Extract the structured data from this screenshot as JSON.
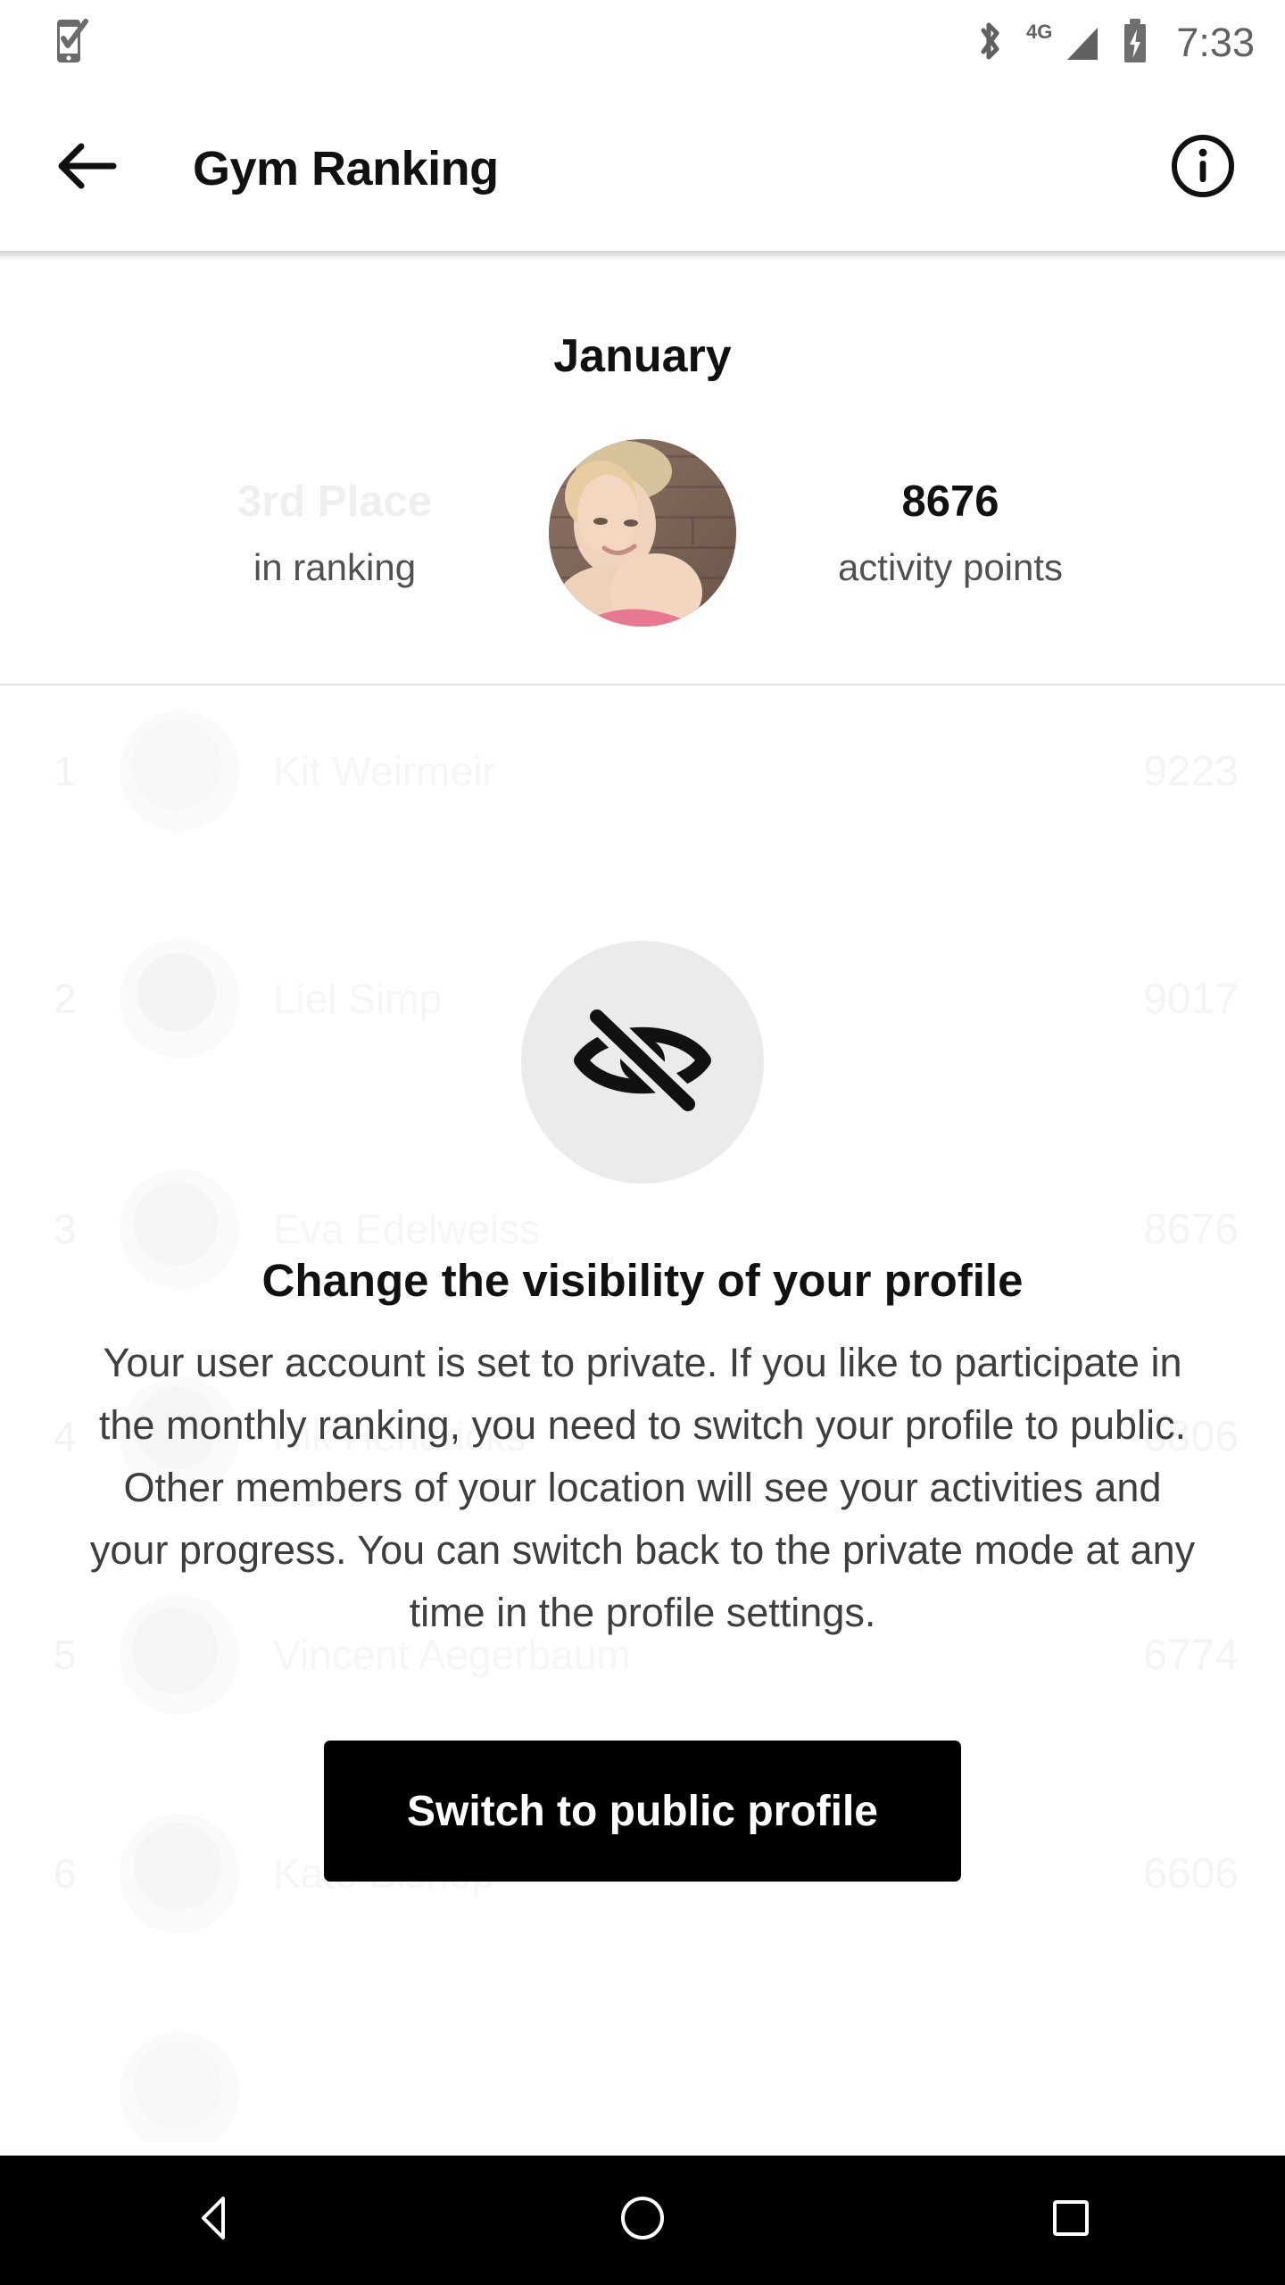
{
  "status_bar": {
    "notification_icon": "phone-check-icon",
    "bluetooth_icon": "bluetooth-icon",
    "network_label": "4G",
    "signal_icon": "signal-bars-icon",
    "battery_icon": "battery-charging-icon",
    "time": "7:33"
  },
  "app_bar": {
    "back_icon": "arrow-left-icon",
    "title": "Gym Ranking",
    "info_icon": "info-circle-icon"
  },
  "summary": {
    "month": "January",
    "place": "3rd Place",
    "place_caption": "in ranking",
    "points": "8676",
    "points_caption": "activity points",
    "avatar_alt": "user-avatar"
  },
  "ranking": {
    "rows": [
      {
        "rank": "1",
        "name": "Kit Weirmeir",
        "score": "9223"
      },
      {
        "rank": "2",
        "name": "Liel Simp",
        "score": "9017"
      },
      {
        "rank": "3",
        "name": "Eva Edelweiss",
        "score": "8676"
      },
      {
        "rank": "4",
        "name": "Nik Hendricks",
        "score": "6806"
      },
      {
        "rank": "5",
        "name": "Vincent Aegerbaum",
        "score": "6774"
      },
      {
        "rank": "6",
        "name": "Kate Bishop",
        "score": "6606"
      }
    ]
  },
  "overlay": {
    "icon": "eye-off-icon",
    "title": "Change the visibility of your profile",
    "body": "Your user account is set to private. If you like to participate in the monthly ranking, you need to switch your profile to public. Other members of your location will see your activities and your progress. You can switch back to the private mode at any time in the profile settings.",
    "button_label": "Switch to public profile"
  },
  "nav_bar": {
    "back_icon": "nav-back-triangle-icon",
    "home_icon": "nav-home-circle-icon",
    "recents_icon": "nav-recents-square-icon"
  },
  "colors": {
    "accent": "#000000",
    "text_primary": "#111111",
    "text_secondary": "#515151",
    "faded": "#f3f3f3",
    "icon_circle_bg": "#ebebeb",
    "status_icon": "#616161"
  }
}
